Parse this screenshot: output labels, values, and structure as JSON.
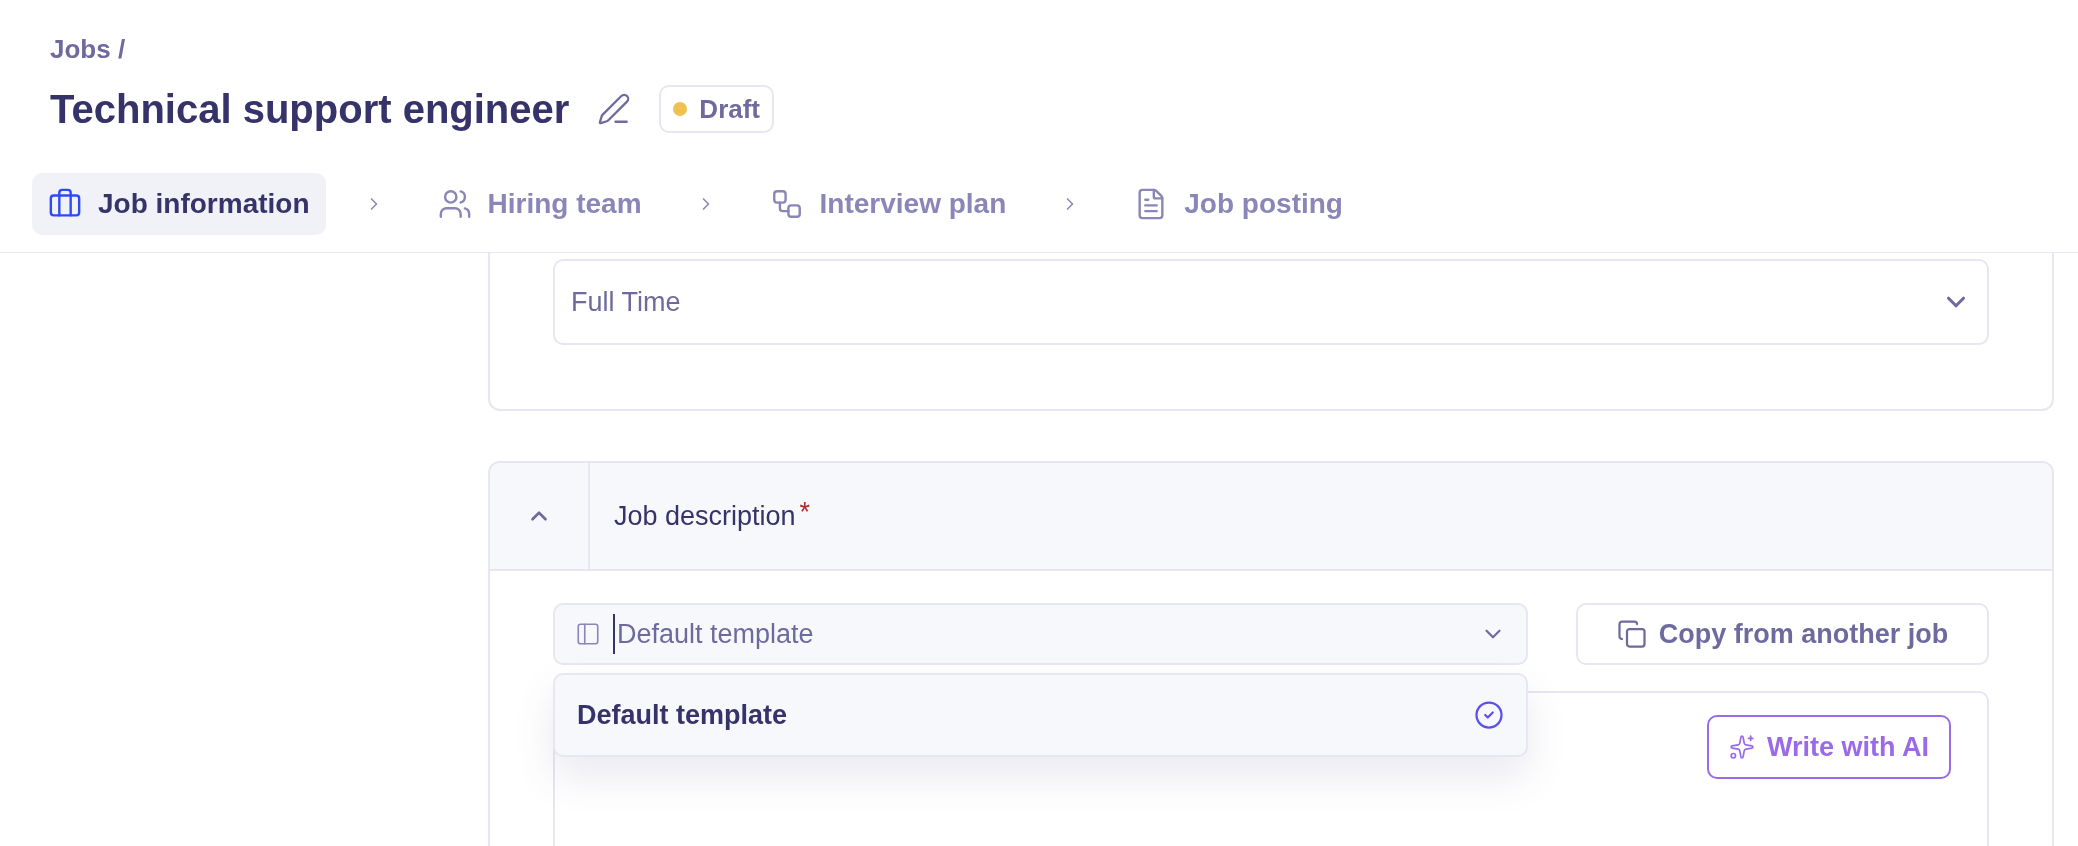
{
  "breadcrumb": "Jobs /",
  "title": "Technical support engineer",
  "status": {
    "label": "Draft",
    "color": "#f0c050"
  },
  "steps": [
    {
      "label": "Job information",
      "selected": true
    },
    {
      "label": "Hiring team",
      "selected": false
    },
    {
      "label": "Interview plan",
      "selected": false
    },
    {
      "label": "Job posting",
      "selected": false
    }
  ],
  "employment_type": {
    "value": "Full Time"
  },
  "job_description": {
    "title": "Job description",
    "required_mark": "*",
    "expanded": true,
    "template_select": {
      "value": "Default template"
    },
    "template_options": [
      {
        "label": "Default template",
        "selected": true
      }
    ],
    "copy_button": "Copy from another job",
    "ai_button": "Write with AI"
  }
}
